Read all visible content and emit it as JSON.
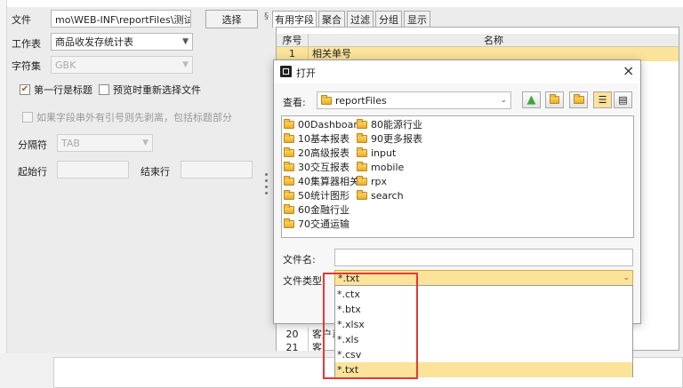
{
  "form": {
    "file_label": "文件",
    "file_value": "mo\\WEB-INF\\reportFiles\\测试.xlsx",
    "select_button": "选择",
    "sheet_label": "工作表",
    "sheet_value": "商品收发存统计表",
    "charset_label": "字符集",
    "charset_value": "GBK",
    "first_row_title": "第一行是标题",
    "reselect_on_preview": "预览时重新选择文件",
    "strip_quotes": "如果字段串外有引号则先剥离，包括标题部分",
    "separator_label": "分隔符",
    "separator_value": "TAB",
    "start_row_label": "起始行",
    "end_row_label": "结束行"
  },
  "tabs": [
    "有用字段",
    "聚合",
    "过滤",
    "分组",
    "显示"
  ],
  "grid": {
    "col_seq": "序号",
    "col_name": "名称",
    "rows": [
      {
        "seq": "1",
        "name": "相关单号"
      },
      {
        "seq": "20",
        "name": "客户系"
      },
      {
        "seq": "21",
        "name": "客户名"
      }
    ]
  },
  "dialog": {
    "title": "打开",
    "close": "×",
    "lookin_label": "查看:",
    "lookin_value": "reportFiles",
    "folders_col1": [
      "00Dashboard",
      "10基本报表",
      "20高级报表",
      "30交互报表",
      "40集算器相关",
      "50统计图形",
      "60金融行业",
      "70交通运输"
    ],
    "folders_col2": [
      "80能源行业",
      "90更多报表",
      "input",
      "mobile",
      "rpx",
      "search"
    ],
    "filename_label": "文件名:",
    "filetype_label": "文件类型:",
    "filetype_value": "*.txt",
    "filetype_options": [
      "*.ctx",
      "*.btx",
      "*.xlsx",
      "*.xls",
      "*.csv",
      "*.txt"
    ]
  },
  "icons": {
    "up": "up-folder-icon",
    "home": "home-icon",
    "new_folder": "new-folder-icon",
    "list": "list-view-icon",
    "details": "details-view-icon"
  },
  "colors": {
    "selection": "#fbe39a",
    "highlight_box": "#e03a3a",
    "up_arrow": "#3fa63a"
  }
}
